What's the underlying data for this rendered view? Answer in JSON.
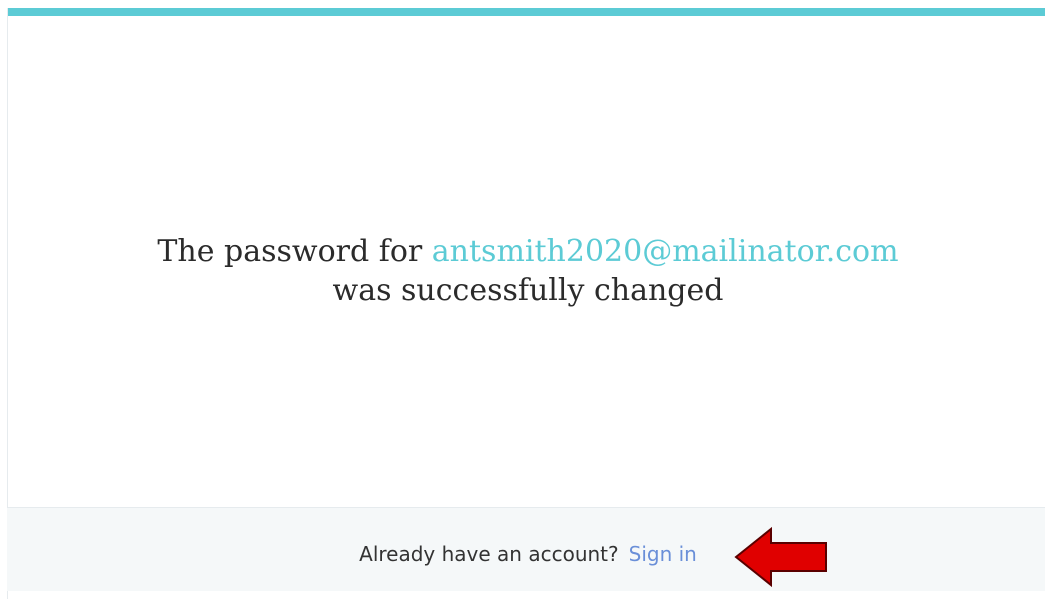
{
  "message": {
    "prefix": "The password for ",
    "email": "antsmith2020@mailinator.com",
    "suffix": "was successfully changed"
  },
  "footer": {
    "prompt": "Already have an account?",
    "signin_label": "Sign in"
  },
  "colors": {
    "accent": "#5ccbd5",
    "link": "#6a8fd8",
    "annotation_arrow": "#e00000"
  },
  "icons": {
    "annotation": "red-arrow-left-icon"
  }
}
